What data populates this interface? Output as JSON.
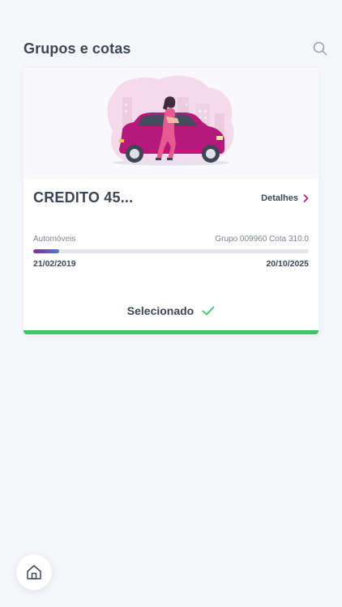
{
  "header": {
    "title": "Grupos e cotas",
    "search_icon": "search-icon"
  },
  "card": {
    "title": "CREDITO 45...",
    "details_label": "Detalhes",
    "category": "Automóveis",
    "group_quota": "Grupo 009960 Cota 310.0",
    "start_date": "21/02/2019",
    "end_date": "20/10/2025",
    "progress_fraction": 0.095,
    "status_label": "Selecionado",
    "status_color": "#41c36a",
    "progress_colors": [
      "#8a2c8f",
      "#4a7bd3"
    ],
    "illustration": "woman-leaning-on-pink-car"
  },
  "footer": {
    "home_icon": "home-icon"
  }
}
